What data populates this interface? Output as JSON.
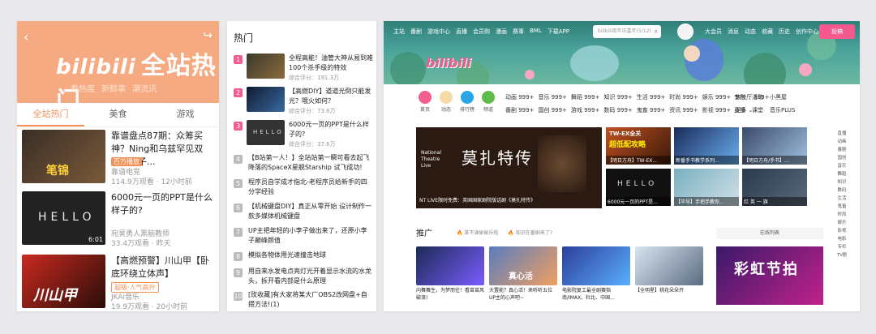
{
  "mobile": {
    "back_glyph": "‹",
    "share_glyph": "↪",
    "logo_text": "bilibili",
    "logo_title": "全站热门",
    "sub_links": [
      "看热度",
      "新鲜事",
      "潮流讯"
    ],
    "tabs": [
      "全站热门",
      "美食",
      "游戏"
    ],
    "items": [
      {
        "title": "靠谱盘点87期：众筹买神？Ning和乌兹罕见双排，枣子...",
        "tag": "百万播放",
        "author": "靠谱电竞",
        "views": "114.9万观看",
        "time": "12小时前",
        "thumb_text": "笔锦"
      },
      {
        "title": "6000元一页的PPT是什么样子的?",
        "author": "宛昊勇人黑脑教师",
        "views": "33.4万观看",
        "time": "昨天",
        "duration": "6:01",
        "thumb_text": "HELLO"
      },
      {
        "title": "【高燃预警】川山甲【卧底环绕立体声】",
        "tag": "超级·人气高升",
        "author": "JKAi音乐",
        "views": "19.9万观看",
        "time": "20小时前",
        "thumb_text": "川山甲"
      }
    ]
  },
  "ranking": {
    "heading": "热门",
    "items": [
      {
        "num": "1",
        "title": "全程高能！油管大神从易到难100个杀手级的特效",
        "score": "综合评分：191.3万"
      },
      {
        "num": "2",
        "title": "【高燃DIY】道道光倒只能发光？哦火如何？",
        "score": "综合评分：73.6万"
      },
      {
        "num": "3",
        "title": "6000元一页的PPT是什么样子的?",
        "score": "综合评分：37.6万",
        "thumb_text": "HELLO"
      },
      {
        "num": "4",
        "title": "【B站第一人！】全站站第一瞬可看去起飞降落的SpaceX星舰Starship 试飞成功!"
      },
      {
        "num": "5",
        "title": "程序员自学成才指北-老程序员给新手的四分学经验"
      },
      {
        "num": "6",
        "title": "【机械键盘DIY】真正从零开始 设计制作一款多媒体机械键盘"
      },
      {
        "num": "7",
        "title": "UP主把年轻的小李子做出来了，还原小李子巅峰颜值"
      },
      {
        "num": "8",
        "title": "模拟各物体用光速撞击地球"
      },
      {
        "num": "9",
        "title": "用自来水发电点亮灯光开着显示水流的水龙头，拆开看内部是什么原理"
      },
      {
        "num": "10",
        "title": "[玫收藏]有大家将某大厂OBS2改网盘+自攒方法!(1)"
      }
    ]
  },
  "desktop": {
    "nav": [
      "主站",
      "番剧",
      "游戏中心",
      "直播",
      "会员购",
      "漫画",
      "赛事",
      "BML",
      "下载APP"
    ],
    "search_placeholder": "bilibili周年庆嘉年(5/12)",
    "search_glyph": "⌕",
    "right_links": [
      "大会员",
      "消息",
      "动态",
      "收藏",
      "历史",
      "创作中心"
    ],
    "upload_label": "投稿",
    "logo_text": "bilibili",
    "left_icons": [
      {
        "label": "首页",
        "color": "#f25d8e"
      },
      {
        "label": "动态",
        "color": "#f5d9a8"
      },
      {
        "label": "排行榜",
        "color": "#29a6e6"
      },
      {
        "label": "频道",
        "color": "#5fbb4a"
      }
    ],
    "cat_rows": [
      [
        "动画 999+",
        "音乐 999+",
        "舞蹈 999+",
        "知识 999+",
        "生活 999+",
        "时尚 999+",
        "娱乐 999+",
        "放映厅 999+"
      ],
      [
        "番剧 999+",
        "国创 999+",
        "游戏 999+",
        "数码 999+",
        "鬼畜 999+",
        "资讯 999+",
        "影视 999+",
        "更多 ⌄"
      ]
    ],
    "side_links": [
      [
        "专栏",
        "活动",
        "小黑屋"
      ],
      [
        "直播",
        "课堂",
        "音乐PLUS"
      ]
    ],
    "feature": {
      "title": "莫扎特传",
      "caption": "NT LIVE限时免费：英国国家剧院版话剧《莫扎特传》",
      "badge": "National Theatre Live"
    },
    "videos": [
      {
        "caption": "【明日方舟】TW-EX..."
      },
      {
        "caption": "超低配攻略",
        "sub": "TW-EX全关"
      },
      {
        "caption": "【明日方舟/手书】..."
      },
      {
        "caption": "新番手书教学系列..."
      },
      {
        "caption": "6000元一页的PPT是..."
      },
      {
        "caption": "【毕导】手把手教你..."
      },
      {
        "caption": "红 英 一 旗"
      }
    ],
    "promo_heading": "推广",
    "promo_links": [
      "某不演偷偷乐啦",
      "知识在番剧来了?"
    ],
    "live_label": "在线列表",
    "cards": [
      {
        "title": "向舞舞生，为梦而往！看苗苗风破浪!",
        "color1": "#1b2a55",
        "color2": "#7a5cff"
      },
      {
        "title": "大置能？真心活！来听听五位UP主的心声吧~",
        "color1": "#5a7cc0",
        "color2": "#f0a060"
      },
      {
        "title": "电影院复工最全剧赛指南/IMAX，杜比、中国...",
        "color1": "#2b3e9a",
        "color2": "#5ab0ff"
      },
      {
        "title": "【全明星】桃花朵朵开",
        "color1": "#d8e6f2",
        "color2": "#5b6a80"
      }
    ],
    "ad_text": "彩虹节拍",
    "right_nav": [
      "直播",
      "动画",
      "番剧",
      "国创",
      "音乐",
      "舞蹈",
      "知识",
      "数码",
      "生活",
      "鬼畜",
      "时尚",
      "娱乐",
      "影视",
      "电影",
      "专栏",
      "TV剧"
    ]
  }
}
